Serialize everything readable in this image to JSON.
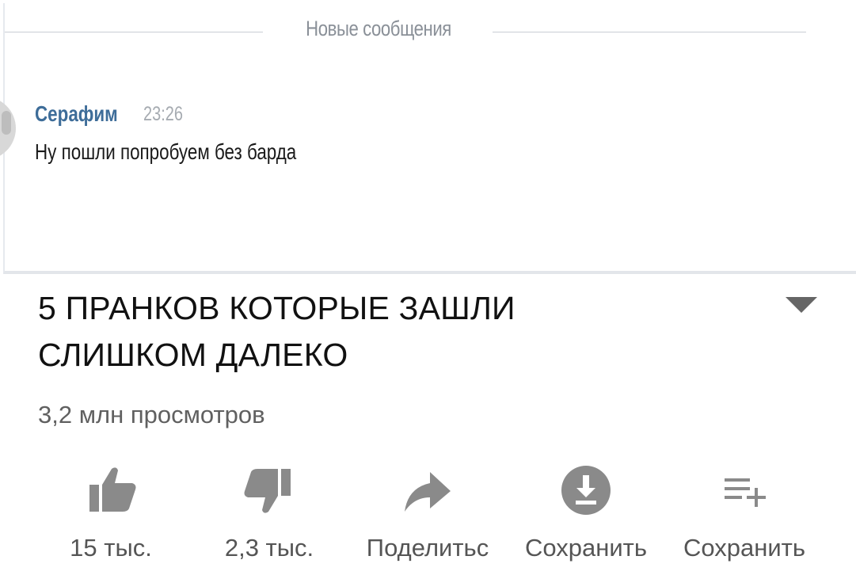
{
  "chat": {
    "divider_label": "Новые сообщения",
    "message": {
      "author": "Серафим",
      "time": "23:26",
      "text": "Ну пошли попробуем без барда"
    }
  },
  "video": {
    "title_line1": "5 ПРАНКОВ КОТОРЫЕ ЗАШЛИ",
    "title_line2": "СЛИШКОМ ДАЛЕКО",
    "views": "3,2 млн просмотров"
  },
  "actions": [
    {
      "icon": "thumbs-up-icon",
      "label": "15 тыс."
    },
    {
      "icon": "thumbs-down-icon",
      "label": "2,3 тыс."
    },
    {
      "icon": "share-icon",
      "label": "Поделитьс"
    },
    {
      "icon": "download-icon",
      "label": "Сохранить"
    },
    {
      "icon": "add-to-playlist-icon",
      "label": "Сохранить"
    }
  ],
  "colors": {
    "author": "#3e6d99",
    "icon": "#8a8a8a",
    "text_secondary": "#606060"
  }
}
